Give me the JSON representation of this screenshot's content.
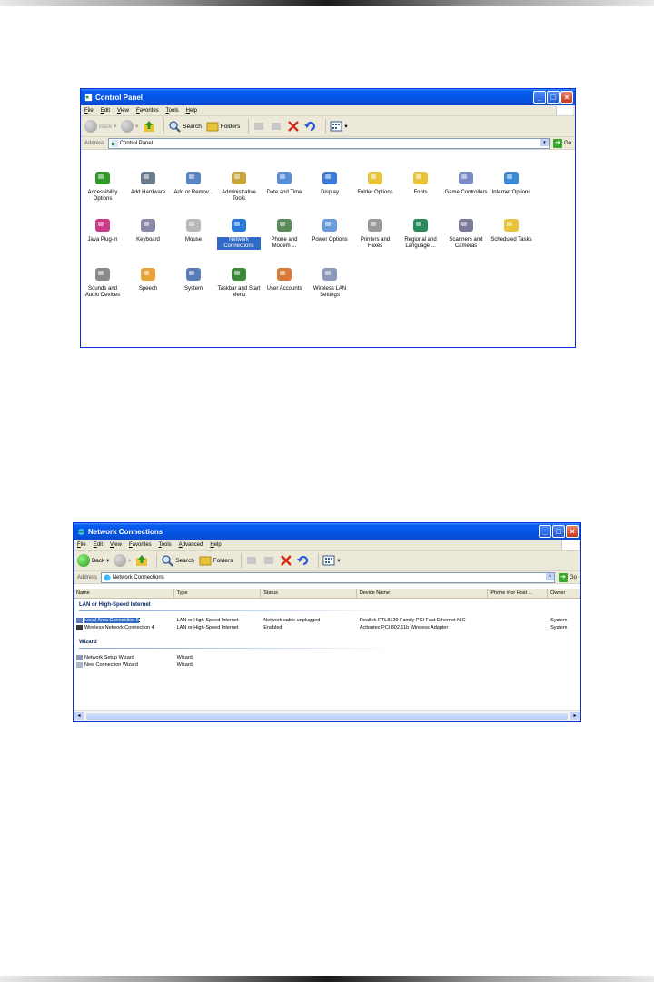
{
  "control_panel": {
    "title": "Control Panel",
    "menu": [
      "File",
      "Edit",
      "View",
      "Favorites",
      "Tools",
      "Help"
    ],
    "toolbar": {
      "back": "Back",
      "search": "Search",
      "folders": "Folders"
    },
    "address_label": "Address",
    "address_value": "Control Panel",
    "go": "Go",
    "items": [
      {
        "label": "Accessibility Options",
        "icon": "accessibility-icon",
        "color": "#2f9a2a"
      },
      {
        "label": "Add Hardware",
        "icon": "add-hardware-icon",
        "color": "#6b7c8c"
      },
      {
        "label": "Add or Remov...",
        "icon": "add-remove-programs-icon",
        "color": "#5a86c8"
      },
      {
        "label": "Administrative Tools",
        "icon": "administrative-tools-icon",
        "color": "#c9a43a"
      },
      {
        "label": "Date and Time",
        "icon": "date-time-icon",
        "color": "#5a8fd8"
      },
      {
        "label": "Display",
        "icon": "display-icon",
        "color": "#3a7ad8"
      },
      {
        "label": "Folder Options",
        "icon": "folder-options-icon",
        "color": "#e8c43a"
      },
      {
        "label": "Fonts",
        "icon": "fonts-icon",
        "color": "#e8c43a"
      },
      {
        "label": "Game Controllers",
        "icon": "game-controllers-icon",
        "color": "#7a8cc8"
      },
      {
        "label": "Internet Options",
        "icon": "internet-options-icon",
        "color": "#3a8ad8"
      },
      {
        "label": "Java Plug-in",
        "icon": "java-plugin-icon",
        "color": "#c83a8a"
      },
      {
        "label": "Keyboard",
        "icon": "keyboard-icon",
        "color": "#8a8aa8"
      },
      {
        "label": "Mouse",
        "icon": "mouse-icon",
        "color": "#b8b8b8"
      },
      {
        "label": "Network Connections",
        "icon": "network-connections-icon",
        "color": "#2a7ad8"
      },
      {
        "label": "Phone and Modem ...",
        "icon": "phone-modem-icon",
        "color": "#5a8a5a"
      },
      {
        "label": "Power Options",
        "icon": "power-options-icon",
        "color": "#6a9ad8"
      },
      {
        "label": "Printers and Faxes",
        "icon": "printers-faxes-icon",
        "color": "#9a9a9a"
      },
      {
        "label": "Regional and Language ...",
        "icon": "regional-language-icon",
        "color": "#2a8a5a"
      },
      {
        "label": "Scanners and Cameras",
        "icon": "scanners-cameras-icon",
        "color": "#7a7a9a"
      },
      {
        "label": "Scheduled Tasks",
        "icon": "scheduled-tasks-icon",
        "color": "#e8c43a"
      },
      {
        "label": "Sounds and Audio Devices",
        "icon": "sounds-audio-icon",
        "color": "#8a8a8a"
      },
      {
        "label": "Speech",
        "icon": "speech-icon",
        "color": "#e8a43a"
      },
      {
        "label": "System",
        "icon": "system-icon",
        "color": "#5a7ab8"
      },
      {
        "label": "Taskbar and Start Menu",
        "icon": "taskbar-start-menu-icon",
        "color": "#3a8a3a"
      },
      {
        "label": "User Accounts",
        "icon": "user-accounts-icon",
        "color": "#d87a3a"
      },
      {
        "label": "Wireless LAN Settings",
        "icon": "wireless-lan-icon",
        "color": "#8a9ab8"
      }
    ]
  },
  "network_connections": {
    "title": "Network Connections",
    "menu": [
      "File",
      "Edit",
      "View",
      "Favorites",
      "Tools",
      "Advanced",
      "Help"
    ],
    "toolbar": {
      "back": "Back",
      "search": "Search",
      "folders": "Folders"
    },
    "address_label": "Address",
    "address_value": "Network Connections",
    "go": "Go",
    "columns": [
      "Name",
      "Type",
      "Status",
      "Device Name",
      "Phone # or Host ...",
      "Owner"
    ],
    "groups": [
      {
        "title": "LAN or High-Speed Internet",
        "rows": [
          {
            "name": "Local Area Connection 5",
            "type": "LAN or High-Speed Internet",
            "status": "Network cable unplugged",
            "device": "Realtek RTL8139 Family PCI Fast Ethernet NIC",
            "phone": "",
            "owner": "System",
            "selected": true
          },
          {
            "name": "Wireless Network Connection 4",
            "type": "LAN or High-Speed Internet",
            "status": "Enabled",
            "device": "Actiontec PCI 802.11b Wireless Adapter",
            "phone": "",
            "owner": "System",
            "selected": false
          }
        ]
      },
      {
        "title": "Wizard",
        "rows": [
          {
            "name": "Network Setup Wizard",
            "type": "Wizard",
            "status": "",
            "device": "",
            "phone": "",
            "owner": "",
            "selected": false
          },
          {
            "name": "New Connection Wizard",
            "type": "Wizard",
            "status": "",
            "device": "",
            "phone": "",
            "owner": "",
            "selected": false
          }
        ]
      }
    ]
  }
}
